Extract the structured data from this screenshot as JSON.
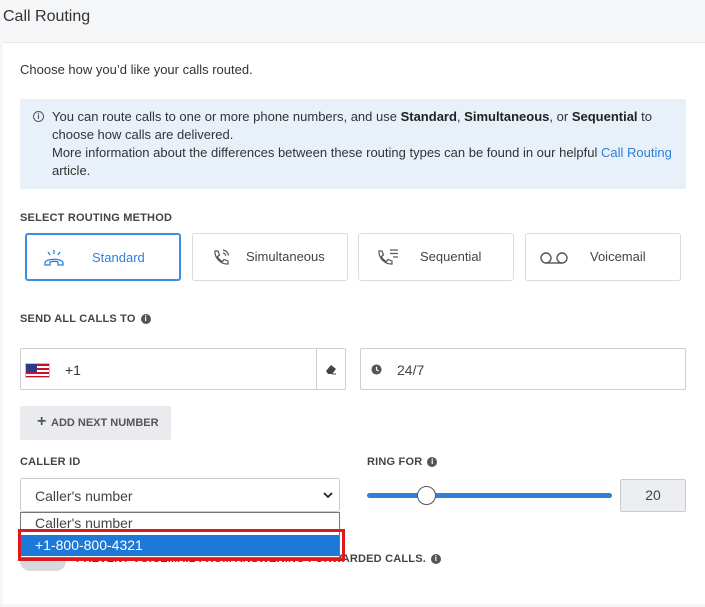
{
  "page_title": "Call Routing",
  "intro": "Choose how you’d like your calls routed.",
  "info": {
    "p1_pre": "You can route calls to one or more phone numbers, and use ",
    "b1": "Standard",
    "sep1": ", ",
    "b2": "Simultaneous",
    "sep2": ", or ",
    "b3": "Sequential",
    "p1_post": " to choose how calls are delivered.",
    "p2_pre": "More information about the differences between these routing types can be found in our helpful ",
    "link": "Call Routing",
    "p2_post": " article."
  },
  "routing": {
    "label": "SELECT ROUTING METHOD",
    "methods": [
      {
        "label": "Standard",
        "icon": "phone-ringing-icon",
        "selected": true
      },
      {
        "label": "Simultaneous",
        "icon": "phone-waves-icon",
        "selected": false
      },
      {
        "label": "Sequential",
        "icon": "phone-list-icon",
        "selected": false
      },
      {
        "label": "Voicemail",
        "icon": "voicemail-icon",
        "selected": false
      }
    ]
  },
  "send_calls": {
    "label": "SEND ALL CALLS TO",
    "country_code": "+1",
    "schedule": "24/7",
    "add_button": "ADD NEXT NUMBER"
  },
  "caller_id": {
    "label": "CALLER ID",
    "selected": "Caller's number",
    "options": [
      "Caller's number",
      "+1-800-800-4321"
    ]
  },
  "ring_for": {
    "label": "RING FOR",
    "value": "20"
  },
  "voicemail_toggle": {
    "label": "PREVENT VOICEMAIL FROM ANSWERING FORWARDED CALLS."
  },
  "colors": {
    "accent": "#2f7fd6",
    "highlight": "#e0191e",
    "option_selected": "#1e78d7"
  }
}
